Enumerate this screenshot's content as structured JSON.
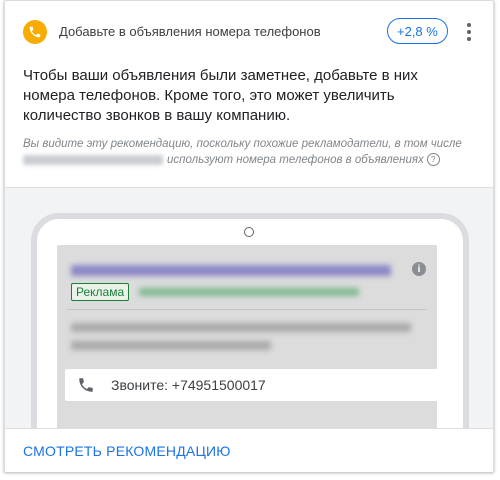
{
  "header": {
    "title": "Добавьте в объявления номера телефонов",
    "uplift": "+2,8 %",
    "icon": "phone-icon",
    "badge_color": "#f9ab00"
  },
  "description": "Чтобы ваши объявления были заметнее, добавьте в них номера телефонов. Кроме того, это может увеличить количество звонков в вашу компанию.",
  "note": {
    "part1": "Вы видите эту рекомендацию, поскольку похожие рекламодатели, в том числе",
    "part2": "используют номера телефонов в объявлениях"
  },
  "ad_preview": {
    "badge": "Реклама",
    "call_extension": "Звоните: +74951500017",
    "call_icon": "phone-icon",
    "info_icon": "info-icon"
  },
  "footer": {
    "link": "СМОТРЕТЬ РЕКОМЕНДАЦИЮ",
    "link_color": "#1a73e8"
  }
}
